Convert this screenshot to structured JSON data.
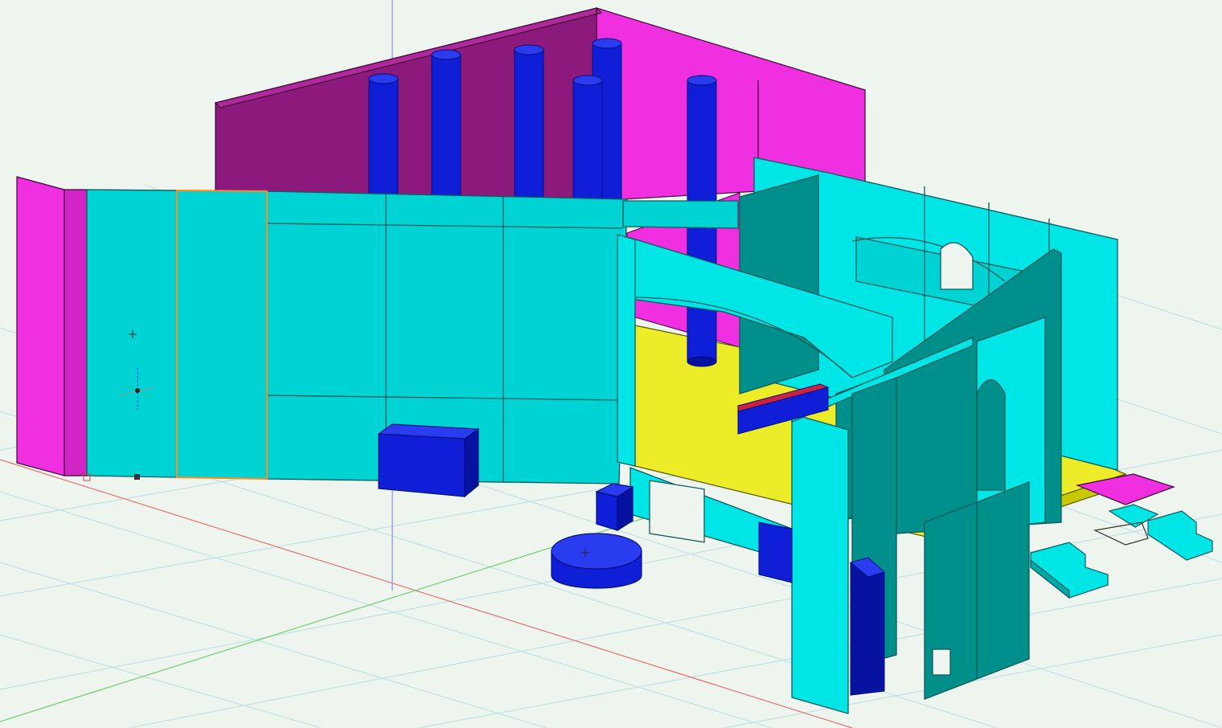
{
  "viewport": {
    "background": "#eef5ee",
    "grid_color": "#b9dde6",
    "axis_colors": {
      "x": "#e87070",
      "y": "#6fd06f",
      "z": "#9aa0f0"
    }
  },
  "palette": {
    "wall_cyan": "#00d3d3",
    "wall_cyan_light": "#00e6e6",
    "wall_teal": "#008f8a",
    "magenta": "#f030e0",
    "magenta_dark": "#8c1a7c",
    "blue": "#0f1fd8",
    "blue_dark": "#0812a0",
    "yellow": "#ecec28",
    "selection": "#ff8c1a",
    "edge": "#0d5b5b"
  },
  "objects": [
    "back-gable-wall",
    "column-1",
    "column-2",
    "column-3",
    "column-4",
    "column-5",
    "column-6",
    "left-end-panel",
    "front-wall-selected-panel",
    "front-wall",
    "blue-box-large",
    "floor-slab",
    "arch-beam",
    "room-walls",
    "blue-cube-small",
    "blue-cylinder-disk",
    "stair-blocks"
  ],
  "icons": [
    "origin-gizmo-icon",
    "crosshair-icon",
    "origin-marker-icon"
  ]
}
